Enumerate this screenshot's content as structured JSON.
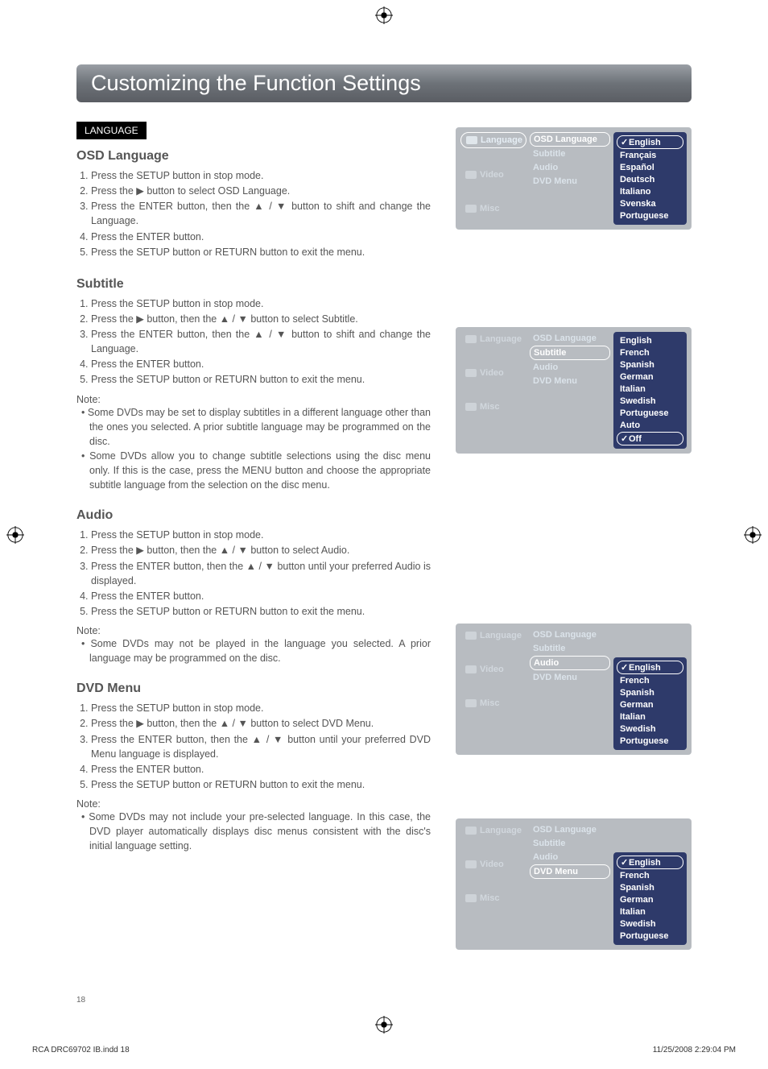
{
  "page": {
    "title": "Customizing the Function Settings",
    "number": "18",
    "footer_left": "RCA DRC69702 IB.indd   18",
    "footer_right": "11/25/2008   2:29:04 PM"
  },
  "language_box_label": "LANGUAGE",
  "sections": {
    "osd": {
      "heading": "OSD Language",
      "steps": [
        "Press the SETUP button in stop mode.",
        "Press the ▶ button to select OSD Language.",
        "Press the ENTER button, then the ▲ / ▼ button to shift and change the Language.",
        "Press the ENTER button.",
        "Press the SETUP button or RETURN button to exit the menu."
      ]
    },
    "subtitle": {
      "heading": "Subtitle",
      "steps": [
        "Press the SETUP button in stop mode.",
        "Press the ▶ button, then the ▲ / ▼ button to select Subtitle.",
        "Press the ENTER button, then the ▲ / ▼ button to shift and change the Language.",
        "Press the ENTER button.",
        "Press the SETUP button or RETURN button to exit the menu."
      ],
      "note_label": "Note:",
      "notes": [
        "Some DVDs may be set to display subtitles in a different language other than the ones you selected. A prior subtitle language may be programmed on the disc.",
        "Some DVDs allow you to change subtitle selections using the disc menu only. If this is the case,  press the MENU button and choose the appropriate subtitle language from the selection on the disc menu."
      ]
    },
    "audio": {
      "heading": "Audio",
      "steps": [
        "Press the SETUP button in stop mode.",
        "Press the ▶ button, then the ▲ / ▼ button to select Audio.",
        "Press the ENTER button, then the ▲ / ▼ button until your preferred Audio is displayed.",
        "Press the ENTER button.",
        "Press the SETUP button or RETURN button to exit the menu."
      ],
      "note_label": "Note:",
      "notes": [
        "Some DVDs may not be played in the language you selected. A prior language may be programmed on the disc."
      ]
    },
    "dvdmenu": {
      "heading": "DVD  Menu",
      "steps": [
        "Press the SETUP button in stop mode.",
        "Press the ▶ button, then the ▲ / ▼ button to select DVD Menu.",
        "Press the ENTER button, then the ▲ / ▼ button until your preferred DVD Menu language is displayed.",
        "Press the ENTER button.",
        "Press the SETUP button or RETURN button to exit the menu."
      ],
      "note_label": "Note:",
      "notes": [
        "Some DVDs may not include your pre-selected language. In this case, the DVD player automatically displays disc menus consistent with the disc's initial language setting."
      ]
    }
  },
  "osd_menus": {
    "tabs": [
      "Language",
      "Video",
      "Misc"
    ],
    "mid_items": [
      "OSD Language",
      "Subtitle",
      "Audio",
      "DVD Menu"
    ],
    "osd_lang_opts": [
      "English",
      "Français",
      "Español",
      "Deutsch",
      "Italiano",
      "Svenska",
      "Portuguese"
    ],
    "subtitle_opts": [
      "English",
      "French",
      "Spanish",
      "German",
      "Italian",
      "Swedish",
      "Portuguese",
      "Auto",
      "Off"
    ],
    "audio_opts": [
      "English",
      "French",
      "Spanish",
      "German",
      "Italian",
      "Swedish",
      "Portuguese"
    ],
    "dvdmenu_opts": [
      "English",
      "French",
      "Spanish",
      "German",
      "Italian",
      "Swedish",
      "Portuguese"
    ],
    "check": "✓"
  }
}
